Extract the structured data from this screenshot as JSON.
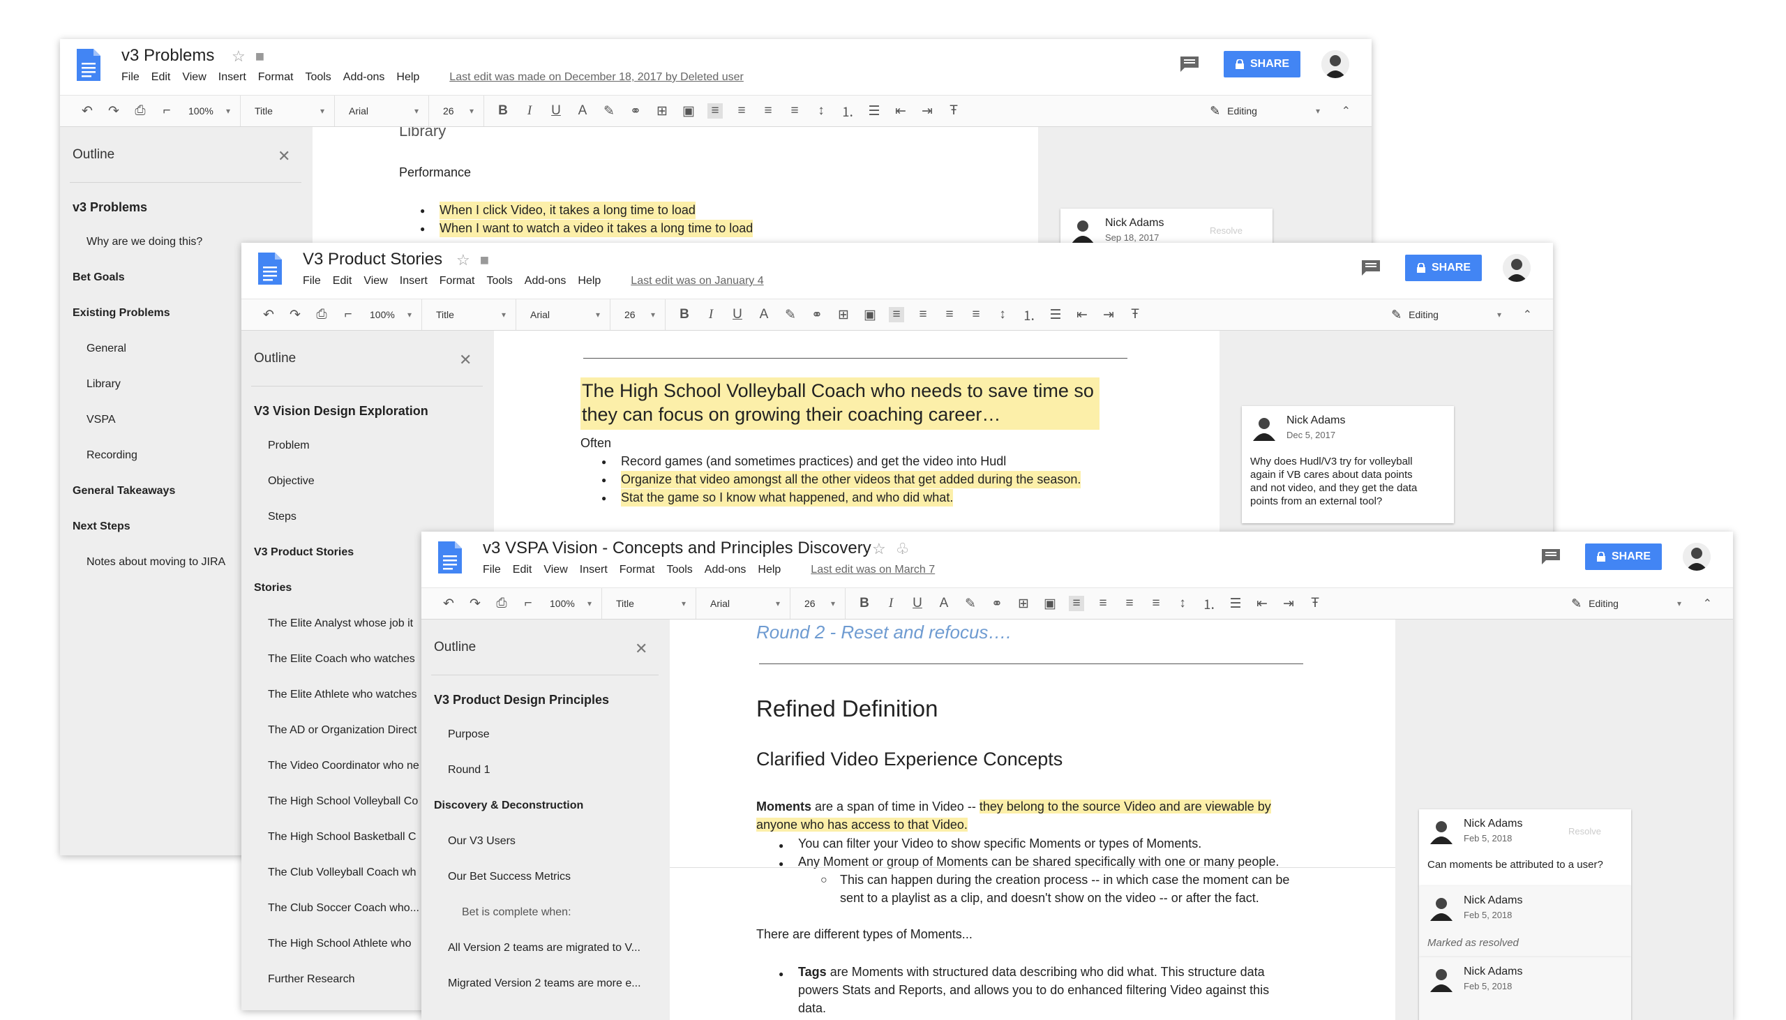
{
  "icons": {
    "doc": "doc-icon",
    "star": "star-icon",
    "folder": "folder-icon",
    "comments": "comment-icon",
    "share_lock": "lock-icon",
    "avatar": "avatar",
    "close": "close-icon",
    "pen": "pencil-icon"
  },
  "colors": {
    "share": "#4285f4",
    "highlight": "#fcefa9",
    "doc_blue": "#4285f4",
    "link_blue": "#6e9bd1",
    "panel_gray": "#eeeeee"
  },
  "common": {
    "menu": [
      "File",
      "Edit",
      "View",
      "Insert",
      "Format",
      "Tools",
      "Add-ons",
      "Help"
    ],
    "share_label": "SHARE",
    "toolbar": {
      "zoom": "100%",
      "style": "Title",
      "font": "Arial",
      "size": "26",
      "mode": "Editing"
    },
    "outline_title": "Outline",
    "close_glyph": "✕",
    "bullet_glyph": "●"
  },
  "win1": {
    "title": "v3 Problems",
    "last_edit": "Last edit was made on December 18, 2017 by Deleted user",
    "outline": [
      {
        "text": "v3 Problems",
        "level": "h1"
      },
      {
        "text": "Why are we doing this?",
        "level": "item"
      },
      {
        "text": "Bet Goals",
        "level": "h2"
      },
      {
        "text": "Existing Problems",
        "level": "h2"
      },
      {
        "text": "General",
        "level": "item"
      },
      {
        "text": "Library",
        "level": "item"
      },
      {
        "text": "VSPA",
        "level": "item"
      },
      {
        "text": "Recording",
        "level": "item"
      },
      {
        "text": "General Takeaways",
        "level": "h2"
      },
      {
        "text": "Next Steps",
        "level": "h2"
      },
      {
        "text": "Notes about moving to JIRA",
        "level": "item"
      }
    ],
    "doc": {
      "heading": "Library",
      "sub": "Performance",
      "bullets": [
        "When I click Video, it  takes a long time to load",
        "When I want to watch a video it takes a long time to load"
      ]
    },
    "comment": {
      "name": "Nick Adams",
      "date": "Sep 18, 2017",
      "resolve": "Resolve"
    }
  },
  "win2": {
    "title": "V3 Product Stories",
    "last_edit": "Last edit was on January 4",
    "outline": [
      {
        "text": "V3 Vision Design Exploration",
        "level": "h1"
      },
      {
        "text": "Problem",
        "level": "item"
      },
      {
        "text": "Objective",
        "level": "item"
      },
      {
        "text": "Steps",
        "level": "item"
      },
      {
        "text": "V3 Product Stories",
        "level": "h2"
      },
      {
        "text": "Stories",
        "level": "h2"
      },
      {
        "text": "The Elite Analyst whose job it",
        "level": "item"
      },
      {
        "text": "The Elite Coach who watches",
        "level": "item"
      },
      {
        "text": "The Elite Athlete who watches",
        "level": "item"
      },
      {
        "text": "The AD or Organization Direct",
        "level": "item"
      },
      {
        "text": "The Video Coordinator who ne",
        "level": "item"
      },
      {
        "text": "The High School Volleyball Co",
        "level": "item"
      },
      {
        "text": "The High School Basketball C",
        "level": "item"
      },
      {
        "text": "The Club Volleyball Coach wh",
        "level": "item"
      },
      {
        "text": "The Club Soccer Coach who...",
        "level": "item"
      },
      {
        "text": "The High School Athlete who",
        "level": "item"
      },
      {
        "text": "Further Research",
        "level": "item"
      }
    ],
    "doc": {
      "heading_line1": "The High School Volleyball Coach who needs to save time so",
      "heading_line2": "they can focus on growing their coaching career…",
      "often": "Often",
      "bullets": [
        {
          "text": "Record games (and sometimes practices) and get the video into Hudl",
          "hl": false
        },
        {
          "text": "Organize that video amongst all the other videos that get added during the season.",
          "hl": true
        },
        {
          "text": "Stat the game so I know what happened, and who did what.",
          "hl": true
        }
      ]
    },
    "comment": {
      "name": "Nick Adams",
      "date": "Dec 5, 2017",
      "lines": [
        "Why does Hudl/V3 try for volleyball",
        "again if VB cares about data points",
        "and not video, and they get the data",
        "points from an external tool?"
      ]
    }
  },
  "win3": {
    "title": "v3 VSPA Vision - Concepts and Principles Discovery",
    "last_edit": "Last edit was on March 7",
    "outline": [
      {
        "text": "V3 Product Design Principles",
        "level": "h1"
      },
      {
        "text": "Purpose",
        "level": "item"
      },
      {
        "text": "Round 1",
        "level": "item"
      },
      {
        "text": "Discovery & Deconstruction",
        "level": "h2"
      },
      {
        "text": "Our V3 Users",
        "level": "item"
      },
      {
        "text": "Our Bet Success Metrics",
        "level": "item"
      },
      {
        "text": "Bet is complete when:",
        "level": "sub"
      },
      {
        "text": "All Version 2 teams are migrated to V...",
        "level": "item"
      },
      {
        "text": "Migrated Version 2 teams are more e...",
        "level": "item"
      }
    ],
    "doc": {
      "round": "Round 2 - Reset and refocus….",
      "h1": "Refined Definition",
      "h2": "Clarified Video Experience Concepts",
      "moments_bold": "Moments",
      "moments_rest": " are a span of time in Video -- ",
      "moments_hl1": "they belong to the source Video and are viewable by",
      "moments_hl2": "anyone who has access to that Video.",
      "b1": "You can filter your Video to show specific Moments or types of Moments.",
      "b2": "Any Moment or group of Moments can be shared specifically with one or many people.",
      "sub1": "This can happen during the creation process -- in which case the moment can be",
      "sub2": "sent to a playlist as a clip, and doesn't show on the video -- or after the fact.",
      "types": "There are different types of Moments...",
      "tags_bold": "Tags",
      "tags1": " are Moments with structured data describing who did what. This structure data",
      "tags2": "powers Stats and Reports, and allows you to do enhanced filtering Video against this",
      "tags3": "data."
    },
    "comments": [
      {
        "name": "Nick Adams",
        "date": "Feb 5, 2018",
        "resolve": "Resolve",
        "text": "Can moments be attributed to a user?"
      },
      {
        "name": "Nick Adams",
        "date": "Feb 5, 2018",
        "text": "Marked as resolved"
      },
      {
        "name": "Nick Adams",
        "date": "Feb 5, 2018"
      }
    ]
  }
}
